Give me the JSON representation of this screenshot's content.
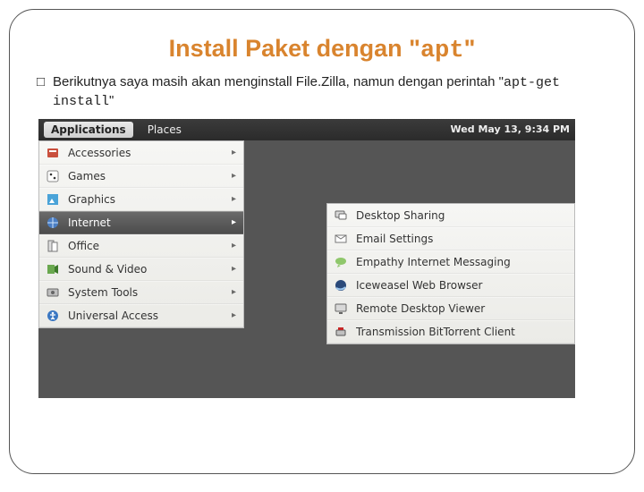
{
  "slide": {
    "title_prefix": "Install Paket dengan \"",
    "title_mono": "apt",
    "title_suffix": "\"",
    "bullet": "□",
    "body_1": "Berikutnya saya masih akan menginstall File.Zilla, namun dengan perintah \"",
    "body_mono": "apt-get install",
    "body_2": "\""
  },
  "panel": {
    "tab_applications": "Applications",
    "tab_places": "Places",
    "clock": "Wed May 13,  9:34 PM"
  },
  "main_menu": [
    {
      "id": "accessories",
      "label": "Accessories",
      "hl": false
    },
    {
      "id": "games",
      "label": "Games",
      "hl": false
    },
    {
      "id": "graphics",
      "label": "Graphics",
      "hl": false
    },
    {
      "id": "internet",
      "label": "Internet",
      "hl": true
    },
    {
      "id": "office",
      "label": "Office",
      "hl": false
    },
    {
      "id": "soundvideo",
      "label": "Sound & Video",
      "hl": false
    },
    {
      "id": "systemtools",
      "label": "System Tools",
      "hl": false
    },
    {
      "id": "universal",
      "label": "Universal Access",
      "hl": false
    }
  ],
  "sub_menu": [
    {
      "id": "desktop-sharing",
      "label": "Desktop Sharing"
    },
    {
      "id": "email-settings",
      "label": "Email Settings"
    },
    {
      "id": "empathy",
      "label": "Empathy Internet Messaging"
    },
    {
      "id": "iceweasel",
      "label": "Iceweasel Web Browser"
    },
    {
      "id": "rdv",
      "label": "Remote Desktop Viewer"
    },
    {
      "id": "transmission",
      "label": "Transmission BitTorrent Client"
    }
  ]
}
